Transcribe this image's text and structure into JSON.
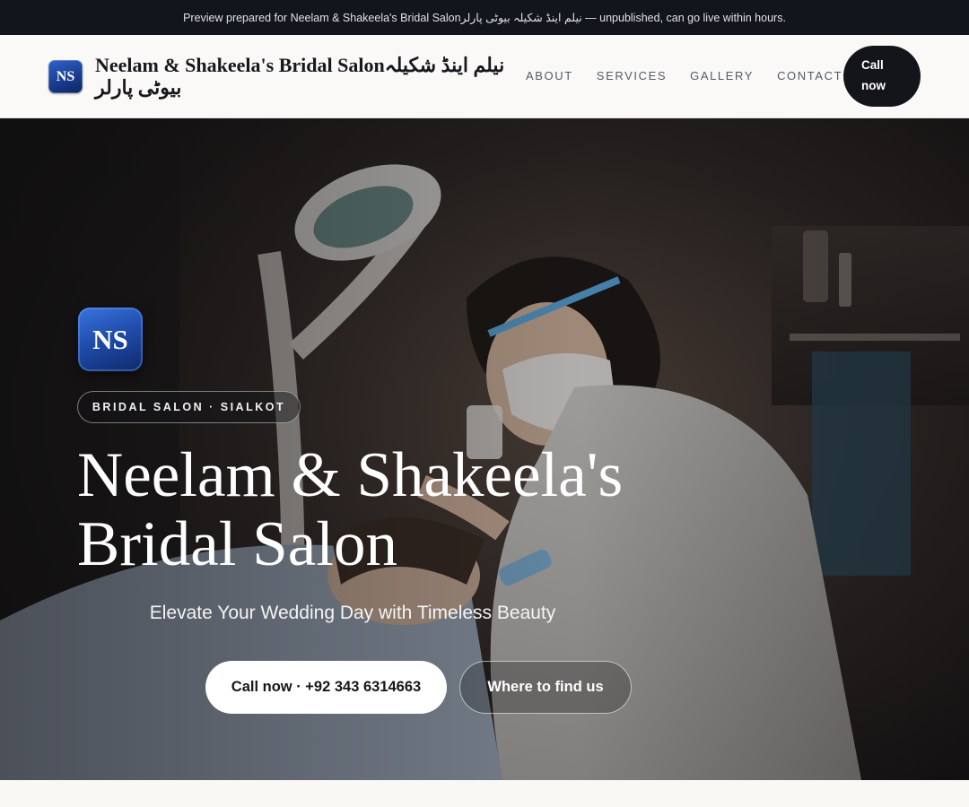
{
  "preview_banner": "Preview prepared for Neelam & Shakeela's Bridal Salonنیلم اینڈ شکیلہ بیوٹی پارلر — unpublished, can go live within hours.",
  "header": {
    "logo_text": "NS",
    "brand_name": "Neelam & Shakeela's Bridal Salonنیلم اینڈ شکیلہ بیوٹی پارلر",
    "nav": [
      "ABOUT",
      "SERVICES",
      "GALLERY",
      "CONTACT"
    ],
    "call_label": "Call now"
  },
  "hero": {
    "logo_text": "NS",
    "tag": "BRIDAL SALON · SIALKOT",
    "title": "Neelam & Shakeela's Bridal Salon",
    "subtitle": "Elevate Your Wedding Day with Timeless Beauty",
    "primary_cta": "Call now · +92 343 6314663",
    "secondary_cta": "Where to find us"
  },
  "colors": {
    "dark": "#13151c",
    "accent_blue": "#1e4aa8",
    "background": "#faf9f7"
  }
}
